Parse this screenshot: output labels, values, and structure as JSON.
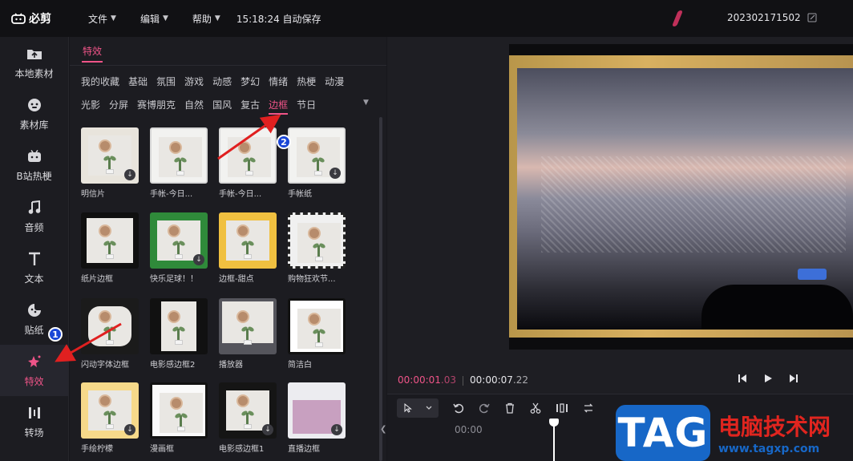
{
  "topbar": {
    "app_name": "必剪",
    "menus": [
      {
        "label": "文件"
      },
      {
        "label": "编辑"
      },
      {
        "label": "帮助"
      }
    ],
    "autosave": "15:18:24 自动保存",
    "project_name": "202302171502"
  },
  "leftnav": {
    "items": [
      {
        "label": "本地素材",
        "icon": "upload-folder-icon"
      },
      {
        "label": "素材库",
        "icon": "face-icon"
      },
      {
        "label": "B站热梗",
        "icon": "tv-icon"
      },
      {
        "label": "音频",
        "icon": "music-note-icon"
      },
      {
        "label": "文本",
        "icon": "text-t-icon"
      },
      {
        "label": "贴纸",
        "icon": "sticker-icon"
      },
      {
        "label": "特效",
        "icon": "sparkle-icon",
        "active": true
      },
      {
        "label": "转场",
        "icon": "transition-icon"
      }
    ]
  },
  "panel": {
    "tab": "特效",
    "categories_row1": [
      "我的收藏",
      "基础",
      "氛围",
      "游戏",
      "动感",
      "梦幻",
      "情绪",
      "热梗",
      "动漫"
    ],
    "categories_row2": [
      "光影",
      "分屏",
      "赛博朋克",
      "自然",
      "国风",
      "复古",
      "边框",
      "节日"
    ],
    "active_category": "边框",
    "effects": [
      {
        "label": "明信片",
        "style": "polaroid"
      },
      {
        "label": "手帐-今日...",
        "style": "paper"
      },
      {
        "label": "手帐-今日...",
        "style": "paper"
      },
      {
        "label": "手帐纸",
        "style": "paper"
      },
      {
        "label": "纸片边框",
        "style": "film"
      },
      {
        "label": "快乐足球！！",
        "style": "green"
      },
      {
        "label": "边框-甜点",
        "style": "sweet"
      },
      {
        "label": "购物狂欢节...",
        "style": "shop"
      },
      {
        "label": "闪动字体边框",
        "style": "flash"
      },
      {
        "label": "电影感边框2",
        "style": "movie"
      },
      {
        "label": "播放器",
        "style": "player"
      },
      {
        "label": "简洁白",
        "style": "simple"
      },
      {
        "label": "手绘柠檬",
        "style": "lemon"
      },
      {
        "label": "漫画框",
        "style": "comic"
      },
      {
        "label": "电影感边框1",
        "style": "movie1"
      },
      {
        "label": "直播边框",
        "style": "live"
      }
    ]
  },
  "player": {
    "current": "00:00:01",
    "current_ms": ".03",
    "total": "00:00:07",
    "total_ms": ".22"
  },
  "timeline": {
    "ruler_start": "00:00"
  },
  "annotations": {
    "badge1": "1",
    "badge2": "2"
  },
  "watermark": {
    "tag": "TAG",
    "title": "电脑技术网",
    "url": "www.tagxp.com"
  },
  "colors": {
    "accent": "#ef5488",
    "arrow": "#e02020",
    "badge": "#1a46d6"
  }
}
